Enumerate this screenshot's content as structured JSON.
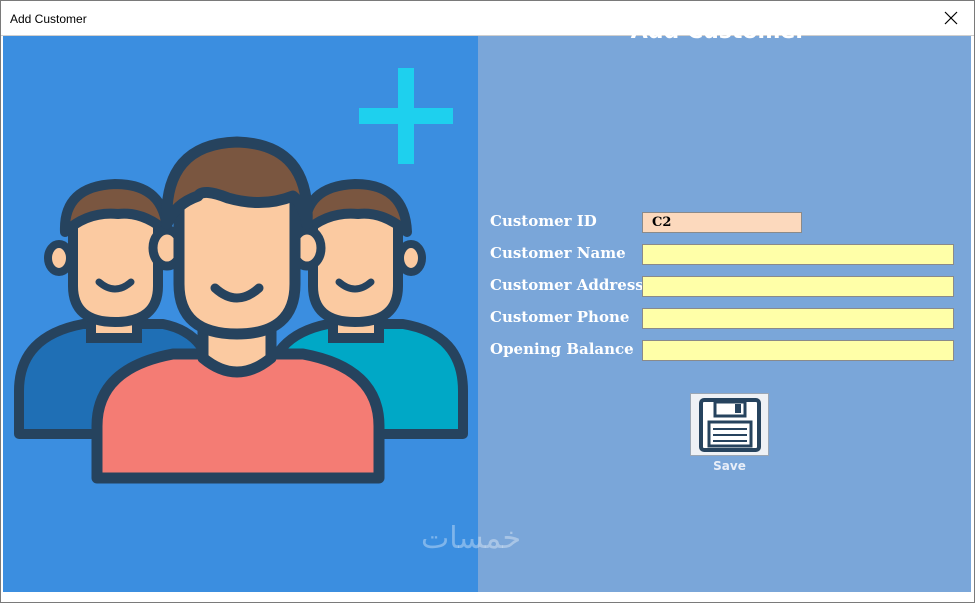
{
  "window": {
    "title": "Add Customer"
  },
  "form": {
    "title": "Add Customer",
    "fields": [
      {
        "label": "Customer ID",
        "value": "C2"
      },
      {
        "label": "Customer Name",
        "value": ""
      },
      {
        "label": "Customer Address",
        "value": ""
      },
      {
        "label": "Customer Phone",
        "value": ""
      },
      {
        "label": "Opening Balance",
        "value": ""
      }
    ],
    "save_label": "Save"
  },
  "watermark": "خمسات",
  "colors": {
    "left_panel": "#3b8ee0",
    "right_panel": "#7aa6d9",
    "id_field": "#fcd9bd",
    "input_field": "#ffffa8",
    "plus_icon": "#1ed0ee",
    "person_center_shirt": "#f47c74",
    "person_left_shirt": "#1f6fb5",
    "person_right_shirt": "#00a8c6",
    "skin": "#fbcaa1",
    "hair": "#7a5640",
    "outline": "#26435e"
  }
}
